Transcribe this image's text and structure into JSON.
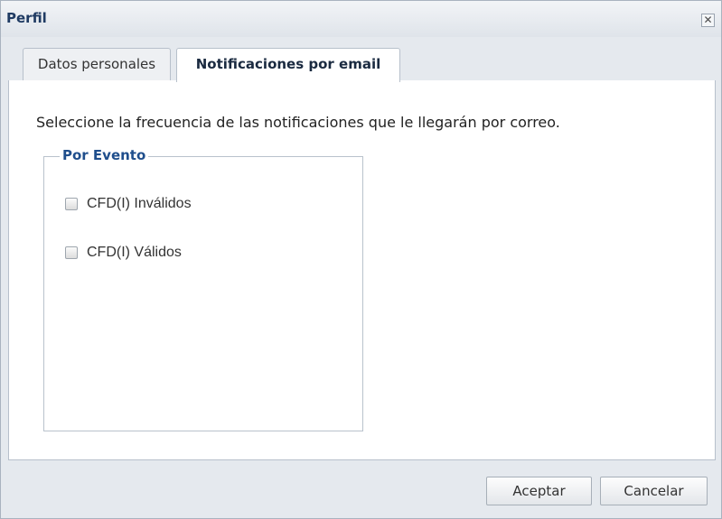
{
  "dialog": {
    "title": "Perfil",
    "close_symbol": "✕",
    "close_icon": "close-icon"
  },
  "tabs": [
    {
      "label": "Datos personales",
      "active": false
    },
    {
      "label": "Notificaciones por email",
      "active": true
    }
  ],
  "content": {
    "intro": "Seleccione la frecuencia de las notificaciones que le llegarán por correo.",
    "fieldset": {
      "legend": "Por Evento",
      "options": [
        {
          "label": "CFD(I) Inválidos",
          "checked": false
        },
        {
          "label": "CFD(I) Válidos",
          "checked": false
        }
      ]
    }
  },
  "footer": {
    "accept_label": "Aceptar",
    "cancel_label": "Cancelar"
  },
  "colors": {
    "accent_blue": "#1f4e8c",
    "title_blue": "#1f3b63"
  }
}
